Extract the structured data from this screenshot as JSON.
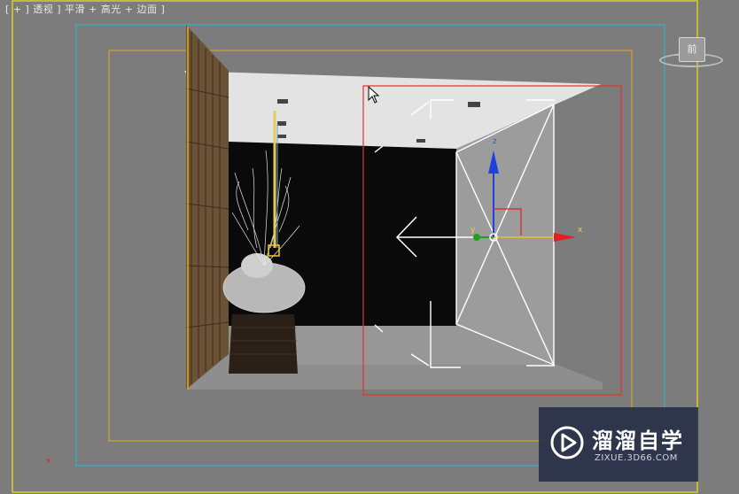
{
  "viewport": {
    "label": "[ + ] 透视 ] 平滑 + 高光 + 边面 ]",
    "viewcube_face": "前"
  },
  "gizmo": {
    "z_axis": "z",
    "x_axis": "x",
    "y_axis": "y"
  },
  "origin_marker": "x",
  "watermark": {
    "title": "溜溜自学",
    "url": "ZIXUE.3D66.COM"
  },
  "colors": {
    "viewport_bg": "#7c7c7c",
    "safe_frame_outer": "#d8d024",
    "safe_frame_cyan": "#31b6c8",
    "safe_frame_orange": "#d7a029",
    "selection_red": "#e8302c",
    "gizmo_x": "#e02020",
    "gizmo_y": "#20a020",
    "gizmo_z": "#2040e0"
  }
}
